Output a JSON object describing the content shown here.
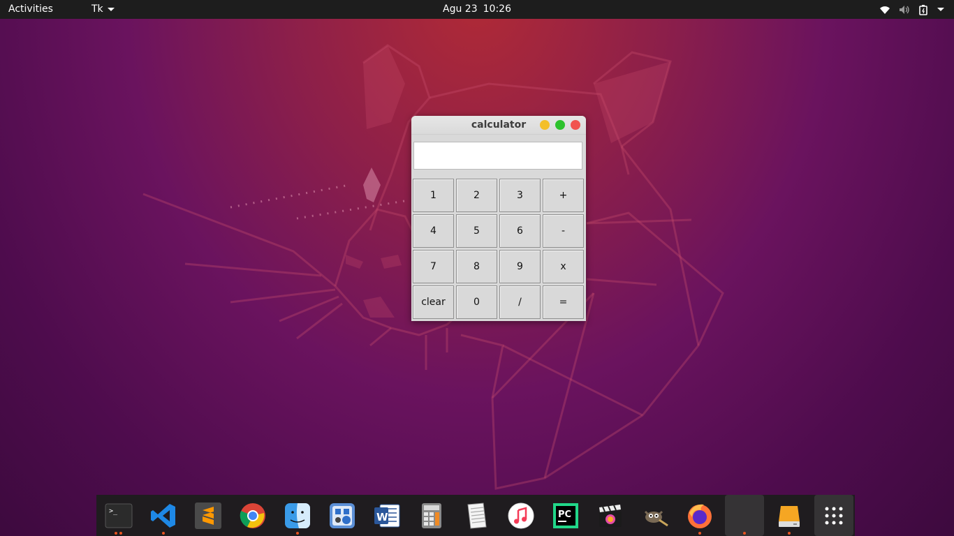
{
  "topbar": {
    "activities": "Activities",
    "app_menu": "Tk",
    "date": "Agu 23",
    "time": "10:26",
    "tray_icons": [
      "wifi-icon",
      "volume-muted-icon",
      "battery-icon",
      "system-menu-caret"
    ]
  },
  "window": {
    "title": "calculator",
    "display_value": "",
    "keys": [
      [
        "1",
        "2",
        "3",
        "+"
      ],
      [
        "4",
        "5",
        "6",
        "-"
      ],
      [
        "7",
        "8",
        "9",
        "x"
      ],
      [
        "clear",
        "0",
        "/",
        "="
      ]
    ]
  },
  "dock": {
    "items": [
      {
        "name": "terminal",
        "icon": "terminal-icon",
        "running_dots": 2
      },
      {
        "name": "vscode",
        "icon": "vscode-icon",
        "running_dots": 1
      },
      {
        "name": "sublime-text",
        "icon": "sublime-icon",
        "running_dots": 0
      },
      {
        "name": "chrome",
        "icon": "chrome-icon",
        "running_dots": 0
      },
      {
        "name": "finder",
        "icon": "finder-icon",
        "running_dots": 1
      },
      {
        "name": "app-store",
        "icon": "appstore-icon",
        "running_dots": 0
      },
      {
        "name": "word",
        "icon": "word-icon",
        "running_dots": 0
      },
      {
        "name": "calculator-app",
        "icon": "calculator-icon",
        "running_dots": 0
      },
      {
        "name": "text-editor",
        "icon": "notepad-icon",
        "running_dots": 0
      },
      {
        "name": "music",
        "icon": "music-icon",
        "running_dots": 0
      },
      {
        "name": "pycharm",
        "icon": "pycharm-icon",
        "running_dots": 0
      },
      {
        "name": "final-cut",
        "icon": "clapper-icon",
        "running_dots": 0
      },
      {
        "name": "gimp",
        "icon": "gimp-icon",
        "running_dots": 0
      },
      {
        "name": "firefox",
        "icon": "firefox-icon",
        "running_dots": 1
      },
      {
        "name": "tk-window",
        "icon": "tk-app-icon",
        "running_dots": 1
      },
      {
        "name": "drive",
        "icon": "drive-icon",
        "running_dots": 1
      },
      {
        "name": "show-apps",
        "icon": "app-grid-icon",
        "running_dots": 0
      }
    ]
  },
  "colors": {
    "topbar_bg": "#1d1d1d",
    "running_dot": "#e95420",
    "window_bg": "#d9d9d9",
    "btn_min": "#f4bf29",
    "btn_max": "#2dc22d",
    "btn_close": "#f1534e"
  }
}
